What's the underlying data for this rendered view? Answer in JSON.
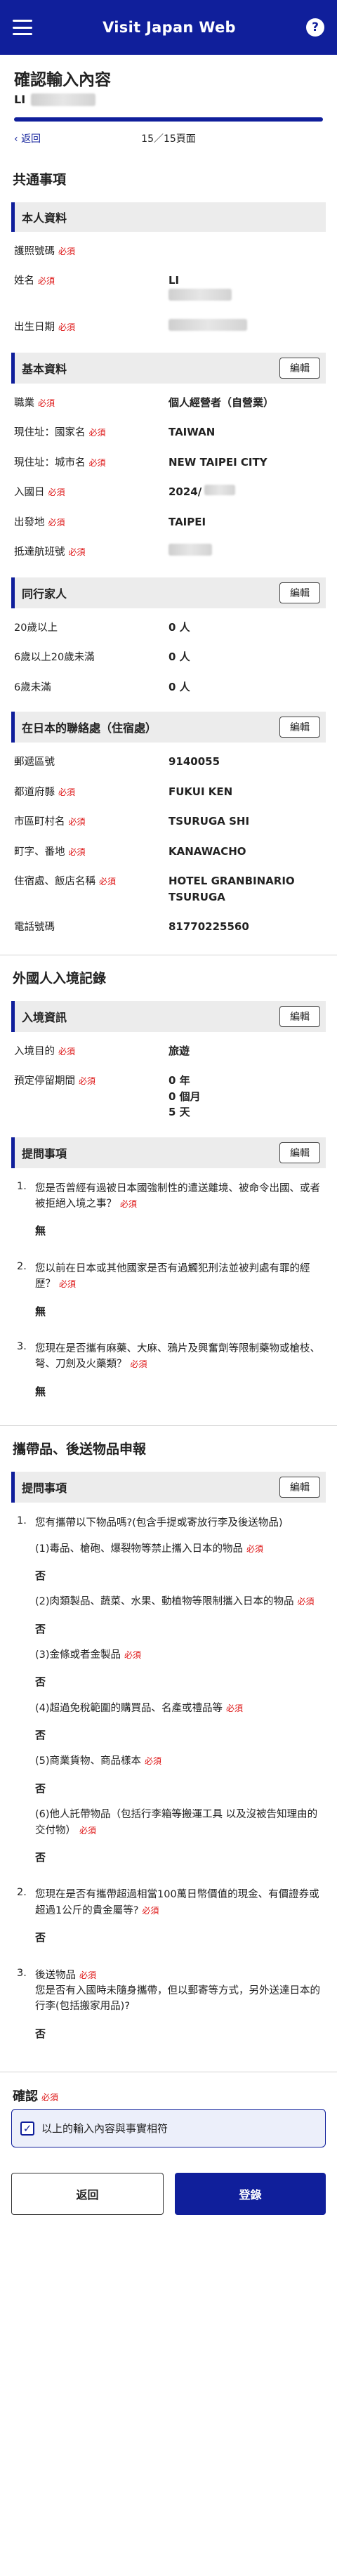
{
  "header": {
    "title": "Visit Japan Web",
    "help": "?"
  },
  "page": {
    "title": "確認輸入內容",
    "user_name": "LI",
    "back_label": "返回",
    "counter": "15／15頁面",
    "progress": 1.0
  },
  "required": "必須",
  "edit_label": "編輯",
  "common": {
    "title": "共通事項",
    "personal": {
      "title": "本人資料",
      "rows": [
        {
          "label": "護照號碼",
          "value": ""
        },
        {
          "label": "姓名",
          "value": "LI"
        },
        {
          "label": "出生日期",
          "value": ""
        }
      ]
    },
    "basic": {
      "title": "基本資料",
      "rows": [
        {
          "label": "職業",
          "value": "個人經營者（自營業）"
        },
        {
          "label": "現住址：國家名",
          "value": "TAIWAN"
        },
        {
          "label": "現住址：城市名",
          "value": "NEW TAIPEI CITY"
        },
        {
          "label": "入國日",
          "value": "2024/"
        },
        {
          "label": "出發地",
          "value": "TAIPEI"
        },
        {
          "label": "抵達航班號",
          "value": ""
        }
      ]
    },
    "family": {
      "title": "同行家人",
      "rows": [
        {
          "label": "20歲以上",
          "value": "0 人"
        },
        {
          "label": "6歲以上20歲未滿",
          "value": "0 人"
        },
        {
          "label": "6歲未滿",
          "value": "0 人"
        }
      ]
    },
    "contact": {
      "title": "在日本的聯絡處（住宿處）",
      "rows": [
        {
          "label": "郵遞區號",
          "value": "9140055"
        },
        {
          "label": "都道府縣",
          "value": "FUKUI KEN"
        },
        {
          "label": "市區町村名",
          "value": "TSURUGA SHI"
        },
        {
          "label": "町字、番地",
          "value": "KANAWACHO"
        },
        {
          "label": "住宿處、飯店名稱",
          "value": "HOTEL GRANBINARIO TSURUGA"
        },
        {
          "label": "電話號碼",
          "value": "81770225560"
        }
      ]
    }
  },
  "immigration": {
    "title": "外國人入境記錄",
    "entry": {
      "title": "入境資訊",
      "purpose_label": "入境目的",
      "purpose_value": "旅遊",
      "stay_label": "預定停留期間",
      "stay_years": "0 年",
      "stay_months": "0 個月",
      "stay_days": "5 天"
    },
    "questions_title": "提問事項",
    "questions": [
      {
        "num": "1.",
        "text": "您是否曾經有過被日本國強制性的遣送離境、被命令出國、或者被拒絕入境之事？",
        "answer": "無"
      },
      {
        "num": "2.",
        "text": "您以前在日本或其他國家是否有過觸犯刑法並被判處有罪的經歷？",
        "answer": "無"
      },
      {
        "num": "3.",
        "text": "您現在是否攜有麻藥、大麻、鴉片及興奮劑等限制藥物或槍枝、弩、刀劍及火藥類？",
        "answer": "無"
      }
    ]
  },
  "customs": {
    "title": "攜帶品、後送物品申報",
    "questions_title": "提問事項",
    "q1": {
      "num": "1.",
      "text": "您有攜帶以下物品嗎?(包含手提或寄放行李及後送物品)",
      "items": [
        {
          "text": "(1)毒品、槍砲、爆裂物等禁止攜入日本的物品",
          "answer": "否"
        },
        {
          "text": "(2)肉類製品、蔬菜、水果、動植物等限制攜入日本的物品",
          "answer": "否"
        },
        {
          "text": "(3)金條或者金製品",
          "answer": "否"
        },
        {
          "text": "(4)超過免稅範圍的購買品、名產或禮品等",
          "answer": "否"
        },
        {
          "text": "(5)商業貨物、商品樣本",
          "answer": "否"
        },
        {
          "text": "(6)他人託帶物品（包括行李箱等搬運工具 以及沒被告知理由的交付物）",
          "answer": "否"
        }
      ]
    },
    "q2": {
      "num": "2.",
      "text": "您現在是否有攜帶超過相當100萬日幣價值的現金、有價證券或超過1公斤的貴金屬等?",
      "answer": "否"
    },
    "q3": {
      "num": "3.",
      "text_title": "後送物品",
      "text": "您是否有入國時未隨身攜帶，但以郵寄等方式，另外送達日本的行李(包括搬家用品)?",
      "answer": "否"
    }
  },
  "confirm": {
    "title": "確認",
    "checkbox_text": "以上的輸入內容與事實相符",
    "check_mark": "✓"
  },
  "footer": {
    "back": "返回",
    "submit": "登錄"
  }
}
